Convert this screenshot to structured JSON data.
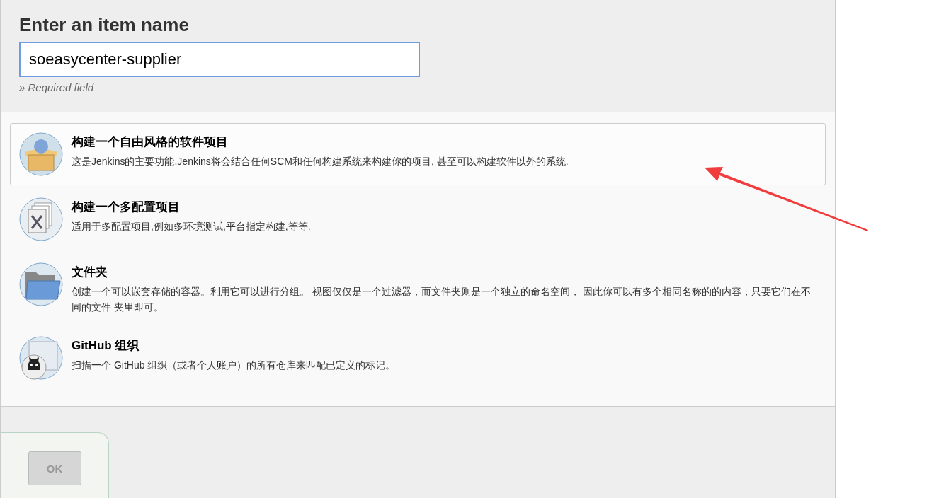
{
  "header": {
    "title": "Enter an item name",
    "name_field": {
      "value": "soeasycenter-supplier"
    },
    "hint": "» Required field"
  },
  "item_types": [
    {
      "kind": "freestyle",
      "name": "构建一个自由风格的软件项目",
      "description": "这是Jenkins的主要功能.Jenkins将会结合任何SCM和任何构建系统来构建你的项目, 甚至可以构建软件以外的系统.",
      "selected": true
    },
    {
      "kind": "matrix",
      "name": "构建一个多配置项目",
      "description": "适用于多配置项目,例如多环境测试,平台指定构建,等等.",
      "selected": false
    },
    {
      "kind": "folder",
      "name": "文件夹",
      "description": "创建一个可以嵌套存储的容器。利用它可以进行分组。 视图仅仅是一个过滤器，而文件夹则是一个独立的命名空间， 因此你可以有多个相同名称的的内容，只要它们在不同的文件 夹里即可。",
      "selected": false
    },
    {
      "kind": "github",
      "name": "GitHub 组织",
      "description": "扫描一个 GitHub 组织（或者个人账户）的所有仓库来匹配已定义的标记。",
      "selected": false
    }
  ],
  "footer": {
    "ok_button": {
      "label": "OK",
      "disabled": true
    }
  }
}
